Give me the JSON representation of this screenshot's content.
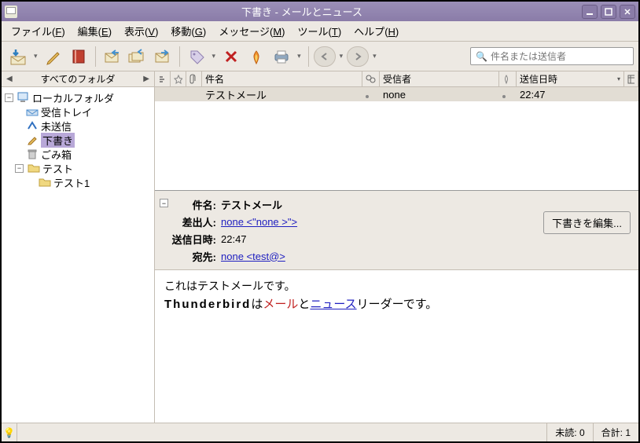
{
  "window": {
    "title": "下書き - メールとニュース"
  },
  "menu": {
    "file": "ファイル",
    "file_u": "F",
    "edit": "編集",
    "edit_u": "E",
    "view": "表示",
    "view_u": "V",
    "go": "移動",
    "go_u": "G",
    "message": "メッセージ",
    "message_u": "M",
    "tools": "ツール",
    "tools_u": "T",
    "help": "ヘルプ",
    "help_u": "H"
  },
  "search": {
    "placeholder": "件名または送信者"
  },
  "sidebar": {
    "title": "すべてのフォルダ",
    "local": "ローカルフォルダ",
    "inbox": "受信トレイ",
    "unsent": "未送信",
    "drafts": "下書き",
    "trash": "ごみ箱",
    "test": "テスト",
    "test1": "テスト1"
  },
  "columns": {
    "subject": "件名",
    "recipient": "受信者",
    "date": "送信日時"
  },
  "message_row": {
    "subject": "テストメール",
    "recipient": "none",
    "date": "22:47"
  },
  "header": {
    "subject_label": "件名:",
    "subject": "テストメール",
    "from_label": "差出人:",
    "from": "none <\"none >\">",
    "date_label": "送信日時:",
    "date": "22:47",
    "to_label": "宛先:",
    "to": "none <test@>",
    "edit_button": "下書きを編集..."
  },
  "body": {
    "line1": "これはテストメールです。",
    "tb": "Thunderbird",
    "ha": "は",
    "mail": "メール",
    "and": "と",
    "news": "ニュース",
    "reader": "リーダーです。"
  },
  "status": {
    "unread_label": "未読:",
    "unread": "0",
    "total_label": "合計:",
    "total": "1"
  }
}
